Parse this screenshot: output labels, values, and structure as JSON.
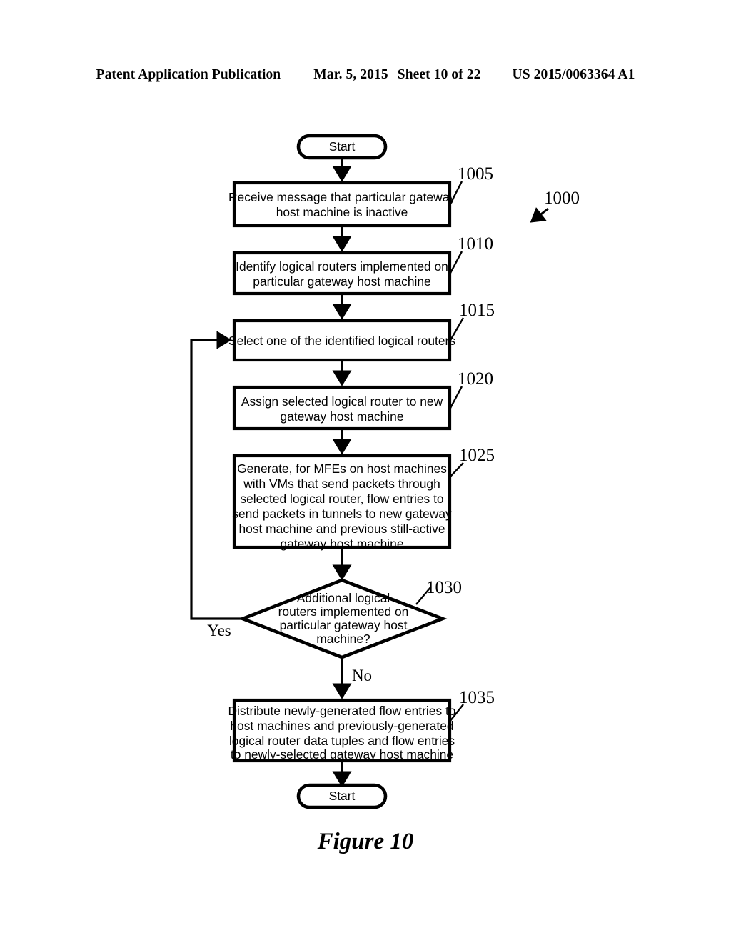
{
  "header": {
    "publication": "Patent Application Publication",
    "date": "Mar. 5, 2015",
    "sheet": "Sheet 10 of 22",
    "patent_number": "US 2015/0063364 A1"
  },
  "figure": {
    "caption": "Figure 10",
    "process_reference": "1000"
  },
  "flowchart": {
    "type": "flowchart",
    "start_terminal": {
      "label": "Start",
      "shape": "rounded-terminal"
    },
    "end_terminal": {
      "label": "Start",
      "shape": "rounded-terminal"
    },
    "steps": [
      {
        "ref": "1005",
        "shape": "process",
        "lines": [
          "Receive message that particular gateway",
          "host machine is inactive"
        ]
      },
      {
        "ref": "1010",
        "shape": "process",
        "lines": [
          "Identify logical routers implemented on",
          "particular gateway host machine"
        ]
      },
      {
        "ref": "1015",
        "shape": "process",
        "lines": [
          "Select one of the identified logical routers"
        ]
      },
      {
        "ref": "1020",
        "shape": "process",
        "lines": [
          "Assign selected logical router to new",
          "gateway host machine"
        ]
      },
      {
        "ref": "1025",
        "shape": "process",
        "lines": [
          "Generate, for MFEs on host machines",
          "with VMs that send packets through",
          "selected logical router, flow entries to",
          "send packets in tunnels to new gateway",
          "host machine and previous still-active",
          "gateway host machine"
        ]
      },
      {
        "ref": "1030",
        "shape": "decision",
        "lines": [
          "Additional logical",
          "routers implemented on",
          "particular gateway host",
          "machine?"
        ],
        "branch_yes": "Yes",
        "branch_no": "No"
      },
      {
        "ref": "1035",
        "shape": "process",
        "lines": [
          "Distribute newly-generated flow entries to",
          "host machines and previously-generated",
          "logical router data tuples and flow entries",
          "to newly-selected gateway host machine"
        ]
      }
    ]
  },
  "colors": {
    "ink": "#000000",
    "paper": "#ffffff"
  }
}
